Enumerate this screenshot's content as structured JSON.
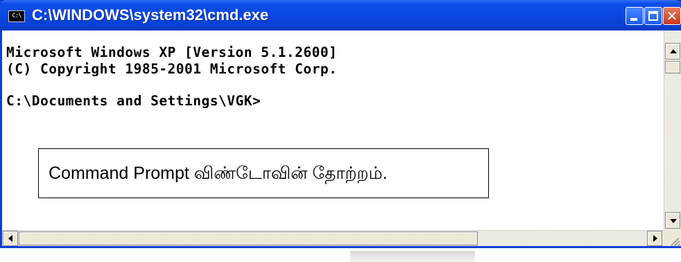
{
  "window": {
    "title": "C:\\WINDOWS\\system32\\cmd.exe",
    "icon_text": "C:\\",
    "controls": {
      "minimize": "minimize-icon",
      "maximize": "maximize-icon",
      "close": "✕"
    }
  },
  "console": {
    "lines": [
      "Microsoft Windows XP [Version 5.1.2600]",
      "(C) Copyright 1985-2001 Microsoft Corp.",
      "",
      "C:\\Documents and Settings\\VGK>"
    ]
  },
  "caption": {
    "text": "Command Prompt விண்டோவின் தோற்றம்."
  },
  "colors": {
    "titlebar": "#0a47df",
    "close_button": "#c8381a",
    "console_background": "#ffffff",
    "console_text": "#000000"
  }
}
